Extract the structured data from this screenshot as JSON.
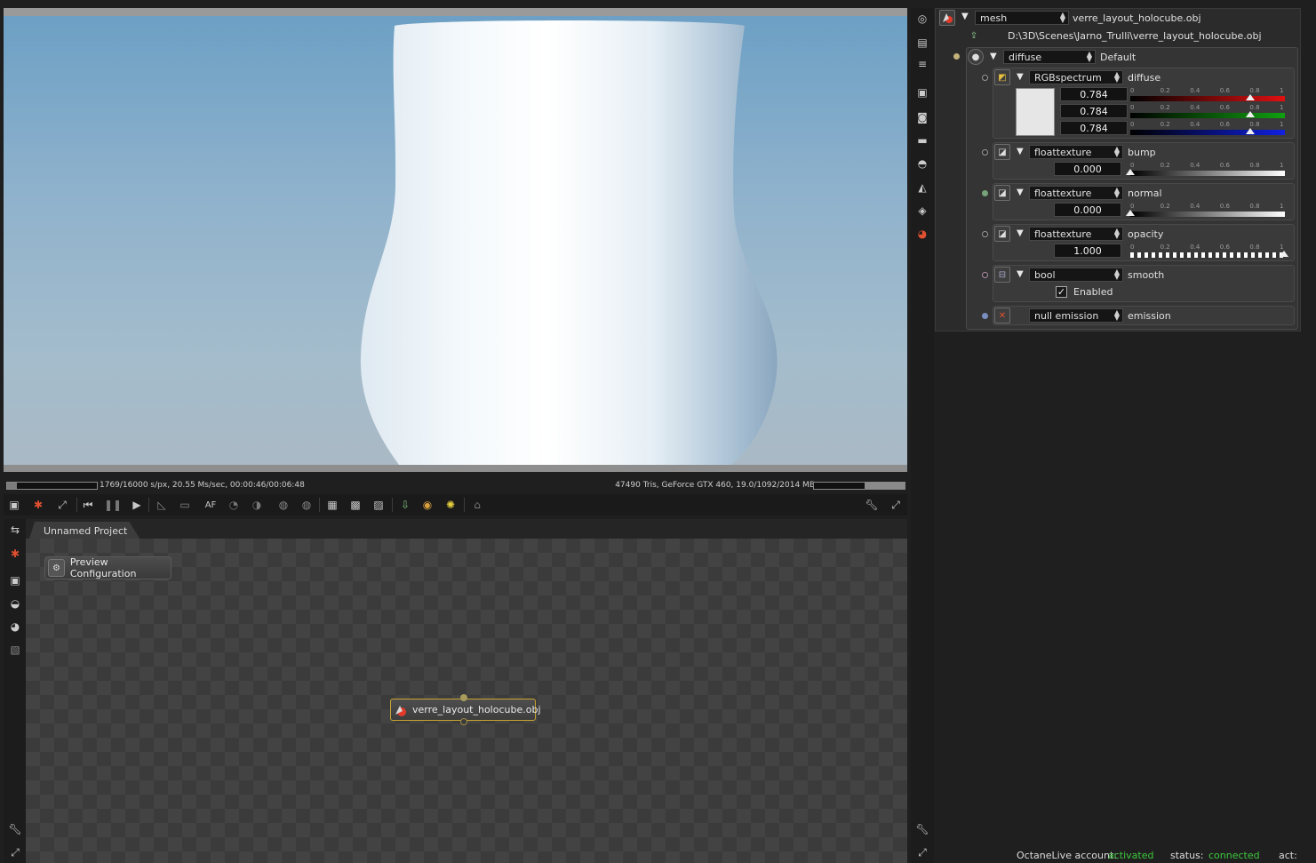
{
  "viewport": {
    "stats_left": "1769/16000 s/px, 20.55 Ms/sec, 00:00:46/00:06:48",
    "stats_right": "47490 Tris, GeForce GTX 460, 19.0/1092/2014 MB",
    "render_progress": 0.11,
    "memory_progress": 0.44
  },
  "graph": {
    "tab_label": "Unnamed Project",
    "preview_config_label": "Preview Configuration",
    "mesh_node_label": "verre_layout_holocube.obj"
  },
  "inspector": {
    "node_type": "mesh",
    "node_name": "verre_layout_holocube.obj",
    "file_path": "D:\\3D\\Scenes\\Jarno_Trulli\\verre_layout_holocube.obj",
    "material_type": "diffuse",
    "material_name": "Default",
    "diffuse": {
      "type": "RGBspectrum",
      "label": "diffuse",
      "r": "0.784",
      "g": "0.784",
      "b": "0.784",
      "swatch_color": "#e6e6e6"
    },
    "bump": {
      "type": "floattexture",
      "label": "bump",
      "value": "0.000"
    },
    "normal": {
      "type": "floattexture",
      "label": "normal",
      "value": "0.000"
    },
    "opacity": {
      "type": "floattexture",
      "label": "opacity",
      "value": "1.000"
    },
    "smooth": {
      "type": "bool",
      "label": "smooth",
      "checkbox_label": "Enabled",
      "checked": true
    },
    "emission": {
      "type": "null emission",
      "label": "emission"
    },
    "slider_ticks": [
      "0",
      "0.2",
      "0.4",
      "0.6",
      "0.8",
      "1"
    ]
  },
  "footer": {
    "account_label": "OctaneLive account:",
    "account_value": "activated",
    "status_label": "status:",
    "status_value": "connected",
    "act_label": "act:"
  },
  "colors": {
    "accent_green": "#3ec83e",
    "node_border": "#c8a431",
    "red_channel": "#e01010",
    "green_channel": "#10a010",
    "blue_channel": "#1020e0"
  }
}
